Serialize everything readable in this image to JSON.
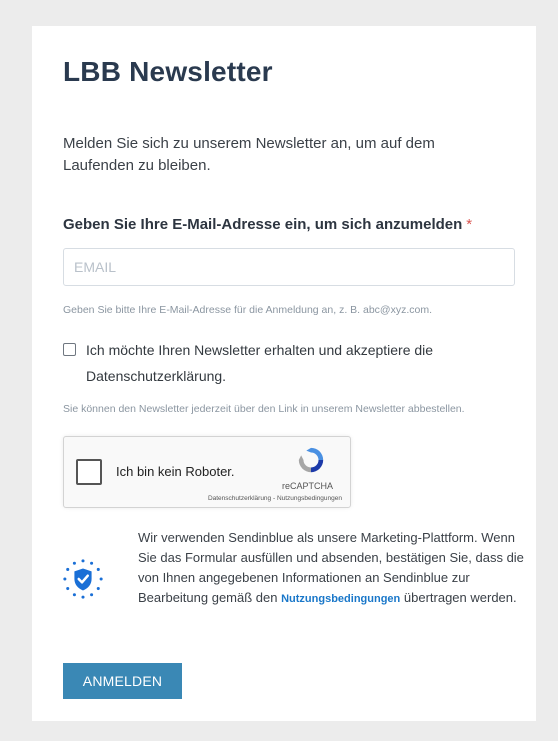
{
  "form": {
    "title": "LBB Newsletter",
    "intro_line1": "Melden Sie sich zu unserem Newsletter an, um auf dem",
    "intro_line2": "Laufenden zu bleiben.",
    "email_label": "Geben Sie Ihre E-Mail-Adresse ein, um sich anzumelden",
    "required_marker": "*",
    "email_placeholder": "EMAIL",
    "email_value": "",
    "email_hint": "Geben Sie bitte Ihre E-Mail-Adresse für die Anmeldung an, z. B. abc@xyz.com.",
    "consent_line1": "Ich möchte Ihren Newsletter erhalten und akzeptiere die",
    "consent_line2": "Datenschutzerklärung.",
    "consent_checked": false,
    "unsubscribe_hint": "Sie können den Newsletter jederzeit über den Link in unserem Newsletter abbestellen.",
    "submit_label": "ANMELDEN"
  },
  "recaptcha": {
    "label": "Ich bin kein Roboter.",
    "brand": "reCAPTCHA",
    "links": "Datenschutzerklärung - Nutzungsbedingungen",
    "checked": false
  },
  "privacy": {
    "text": "Wir verwenden Sendinblue als unsere Marketing-Plattform. Wenn Sie das Formular ausfüllen und absenden, bestätigen Sie, dass die von Ihnen angegebenen Informationen an Sendinblue zur Bearbeitung gemäß den",
    "link_label": "Nutzungsbedingungen",
    "text_end": "übertragen werden."
  },
  "colors": {
    "background": "#ececec",
    "title": "#2a3a4f",
    "required": "#d9534f",
    "link": "#1977c9",
    "button": "#3a88b5",
    "shield": "#1a6fd6"
  },
  "icons": {
    "shield": "eu-shield-check-icon",
    "recaptcha": "recaptcha-logo-icon"
  }
}
